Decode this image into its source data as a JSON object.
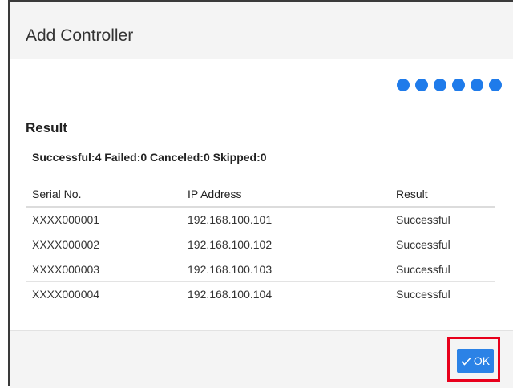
{
  "dialog": {
    "title": "Add Controller",
    "progress": {
      "steps_total": 6,
      "steps_complete": 6,
      "color": "#1f7bea"
    }
  },
  "result": {
    "heading": "Result",
    "summary": "Successful:4 Failed:0 Canceled:0 Skipped:0",
    "columns": [
      "Serial No.",
      "IP Address",
      "Result"
    ],
    "rows": [
      [
        "XXXX000001",
        "192.168.100.101",
        "Successful"
      ],
      [
        "XXXX000002",
        "192.168.100.102",
        "Successful"
      ],
      [
        "XXXX000003",
        "192.168.100.103",
        "Successful"
      ],
      [
        "XXXX000004",
        "192.168.100.104",
        "Successful"
      ]
    ]
  },
  "footer": {
    "ok_label": "OK",
    "ok_icon": "check-icon",
    "ok_color": "#2b82e6",
    "highlight_color": "#e8001c"
  }
}
